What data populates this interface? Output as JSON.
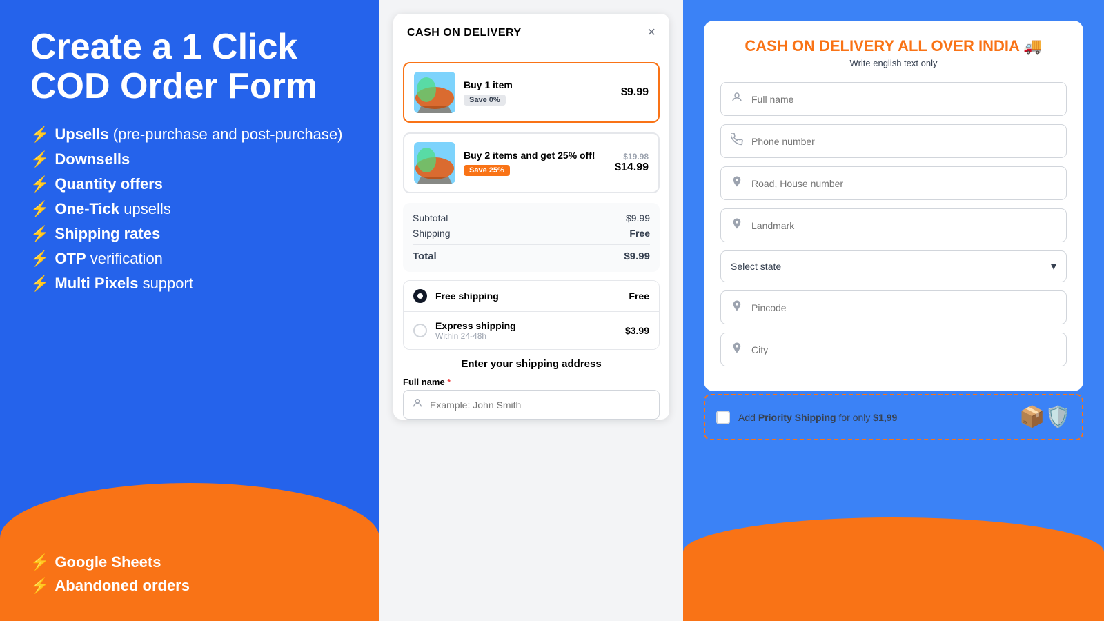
{
  "leftPanel": {
    "title": "Create a 1 Click COD Order Form",
    "features": [
      {
        "bold": "Upsells",
        "normal": " (pre-purchase and post-purchase)"
      },
      {
        "bold": "Downsells",
        "normal": ""
      },
      {
        "bold": "Quantity offers",
        "normal": ""
      },
      {
        "bold": "One-Tick",
        "normal": " upsells"
      },
      {
        "bold": "Shipping rates",
        "normal": ""
      },
      {
        "bold": "OTP",
        "normal": " verification"
      },
      {
        "bold": "Multi Pixels",
        "normal": " support"
      }
    ],
    "orangeFeatures": [
      {
        "bold": "Google Sheets",
        "normal": ""
      },
      {
        "bold": "Abandoned orders",
        "normal": ""
      }
    ]
  },
  "modal": {
    "title": "CASH ON DELIVERY",
    "closeLabel": "×",
    "products": [
      {
        "title": "Buy 1 item",
        "badge": "Save 0%",
        "badgeStyle": "gray",
        "price": "$9.99",
        "oldPrice": null,
        "selected": true
      },
      {
        "title": "Buy 2 items and get 25% off!",
        "badge": "Save 25%",
        "badgeStyle": "orange",
        "price": "$14.99",
        "oldPrice": "$19.98",
        "selected": false
      }
    ],
    "summary": {
      "subtotalLabel": "Subtotal",
      "subtotalValue": "$9.99",
      "shippingLabel": "Shipping",
      "shippingValue": "Free",
      "totalLabel": "Total",
      "totalValue": "$9.99"
    },
    "shippingOptions": [
      {
        "name": "Free shipping",
        "sub": "",
        "price": "Free",
        "selected": true
      },
      {
        "name": "Express shipping",
        "sub": "Within 24-48h",
        "price": "$3.99",
        "selected": false
      }
    ],
    "addressTitle": "Enter your shipping address",
    "addressFields": [
      {
        "label": "Full name",
        "required": true,
        "placeholder": "Example: John Smith",
        "icon": "👤"
      }
    ]
  },
  "rightPanel": {
    "cardTitle": "CASH ON DELIVERY ALL OVER INDIA 🚚",
    "cardSubtitle": "Write english text only",
    "fields": [
      {
        "placeholder": "Full name",
        "icon": "person"
      },
      {
        "placeholder": "Phone number",
        "icon": "phone"
      },
      {
        "placeholder": "Road, House number",
        "icon": "location"
      },
      {
        "placeholder": "Landmark",
        "icon": "location"
      }
    ],
    "stateSelect": "Select state",
    "extraFields": [
      {
        "placeholder": "Pincode",
        "icon": "location"
      },
      {
        "placeholder": "City",
        "icon": "location"
      }
    ],
    "priorityBox": {
      "text1": "Add ",
      "bold": "Priority Shipping",
      "text2": " for only ",
      "price": "$1,99"
    }
  }
}
